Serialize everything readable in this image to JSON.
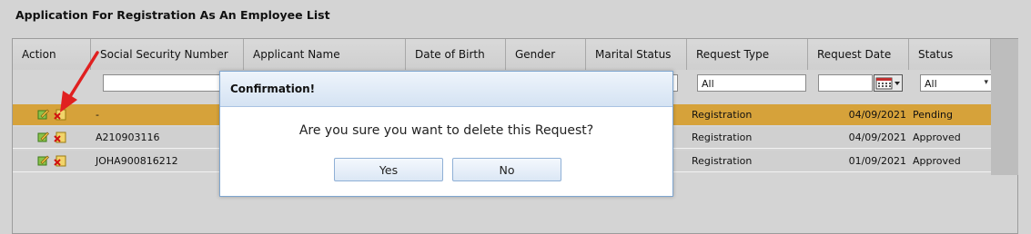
{
  "page": {
    "title": "Application For Registration As An Employee List"
  },
  "grid": {
    "columns": [
      "Action",
      "Social Security Number",
      "Applicant Name",
      "Date of Birth",
      "Gender",
      "Marital Status",
      "Request Type",
      "Request Date",
      "Status"
    ],
    "filters": {
      "request_type": "All",
      "status": "All"
    },
    "rows": [
      {
        "ssn": "-",
        "request_type": "Registration",
        "request_date": "04/09/2021",
        "status": "Pending",
        "selected": true
      },
      {
        "ssn": "A210903116",
        "request_type": "Registration",
        "request_date": "04/09/2021",
        "status": "Approved",
        "selected": false
      },
      {
        "ssn": "JOHA900816212",
        "request_type": "Registration",
        "request_date": "01/09/2021",
        "status": "Approved",
        "selected": false
      }
    ]
  },
  "dialog": {
    "title": "Confirmation!",
    "message": "Are you sure you want to delete this Request?",
    "yes_label": "Yes",
    "no_label": "No"
  },
  "colors": {
    "selected_row": "#d6a23a",
    "arrow": "#e02020",
    "dialog_border": "#7ea5cf"
  },
  "icons": {
    "edit": "edit-icon",
    "delete": "delete-icon",
    "calendar": "calendar-icon"
  }
}
